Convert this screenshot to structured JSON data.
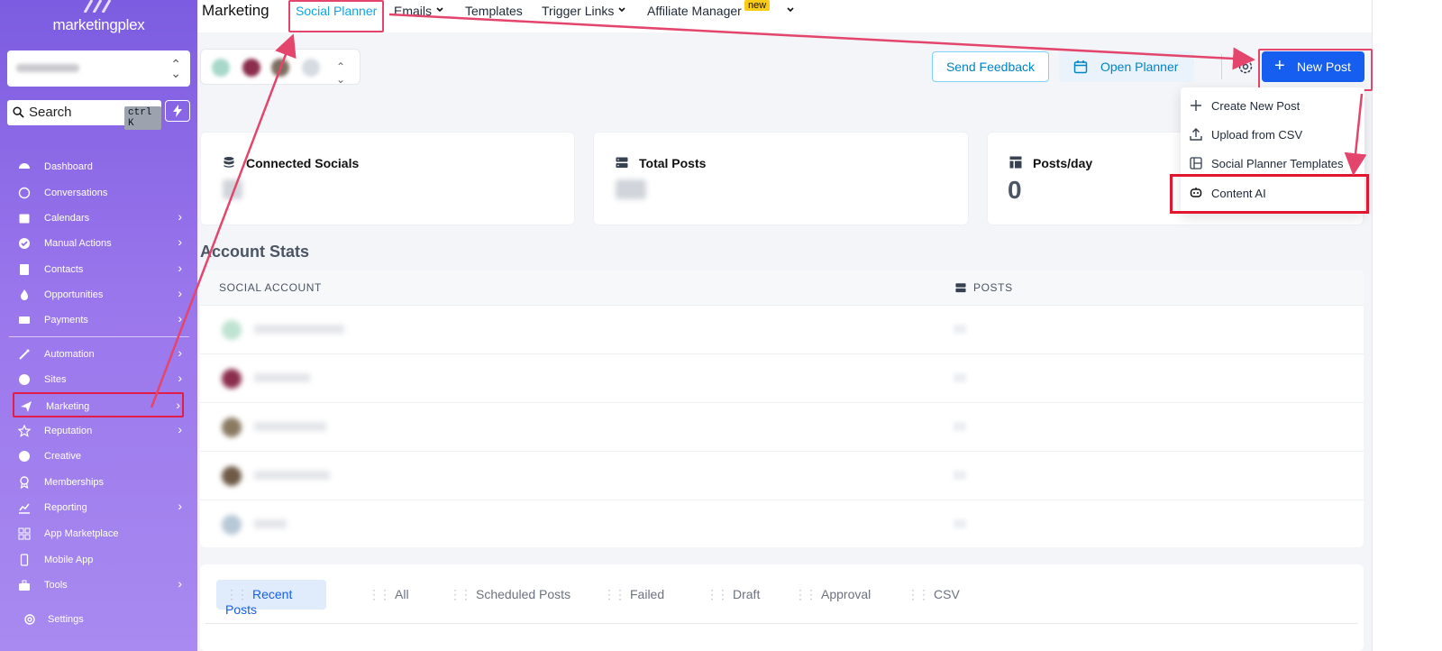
{
  "sidebar": {
    "logo_text": "marketingplex",
    "search_label": "Search",
    "search_shortcut": "ctrl K",
    "items": [
      {
        "label": "Dashboard",
        "icon": "dashboard-icon",
        "has_children": false
      },
      {
        "label": "Conversations",
        "icon": "chat-icon",
        "has_children": false
      },
      {
        "label": "Calendars",
        "icon": "calendar-icon",
        "has_children": true
      },
      {
        "label": "Manual Actions",
        "icon": "check-circle-icon",
        "has_children": true
      },
      {
        "label": "Contacts",
        "icon": "contacts-icon",
        "has_children": true
      },
      {
        "label": "Opportunities",
        "icon": "flame-icon",
        "has_children": true
      },
      {
        "label": "Payments",
        "icon": "credit-card-icon",
        "has_children": true
      },
      {
        "label": "Automation",
        "icon": "magic-wand-icon",
        "has_children": true
      },
      {
        "label": "Sites",
        "icon": "globe-icon",
        "has_children": true
      },
      {
        "label": "Marketing",
        "icon": "paper-plane-icon",
        "has_children": true
      },
      {
        "label": "Reputation",
        "icon": "star-icon",
        "has_children": true
      },
      {
        "label": "Creative",
        "icon": "palette-icon",
        "has_children": false
      },
      {
        "label": "Memberships",
        "icon": "award-icon",
        "has_children": false
      },
      {
        "label": "Reporting",
        "icon": "chart-icon",
        "has_children": true
      },
      {
        "label": "App Marketplace",
        "icon": "grid-icon",
        "has_children": false
      },
      {
        "label": "Mobile App",
        "icon": "mobile-icon",
        "has_children": false
      },
      {
        "label": "Tools",
        "icon": "toolbox-icon",
        "has_children": true
      }
    ],
    "settings_label": "Settings"
  },
  "header": {
    "title": "Marketing",
    "tabs": [
      {
        "label": "Social Planner",
        "active": true
      },
      {
        "label": "Emails",
        "active": false
      },
      {
        "label": "Templates",
        "active": false
      },
      {
        "label": "Trigger Links",
        "active": false
      },
      {
        "label": "Affiliate Manager",
        "active": false
      }
    ],
    "new_badge": "new"
  },
  "toolbar": {
    "send_feedback": "Send Feedback",
    "open_planner": "Open Planner",
    "new_post": "New Post"
  },
  "new_post_menu": [
    {
      "label": "Create New Post",
      "icon": "plus-icon"
    },
    {
      "label": "Upload from CSV",
      "icon": "upload-icon"
    },
    {
      "label": "Social Planner Templates",
      "icon": "template-icon"
    },
    {
      "label": "Content AI",
      "icon": "robot-icon"
    }
  ],
  "stats": {
    "connected_socials": "Connected Socials",
    "total_posts": "Total Posts",
    "posts_per_day": "Posts/day",
    "posts_per_day_value": "0"
  },
  "account_stats": {
    "title": "Account Stats",
    "columns": [
      "SOCIAL ACCOUNT",
      "POSTS"
    ]
  },
  "post_tabs": [
    "Recent Posts",
    "All",
    "Scheduled Posts",
    "Failed",
    "Draft",
    "Approval",
    "CSV"
  ],
  "colors": {
    "accent": "#155eef",
    "sidebar_top": "#7c5ce0",
    "annotation": "#e4456c"
  }
}
